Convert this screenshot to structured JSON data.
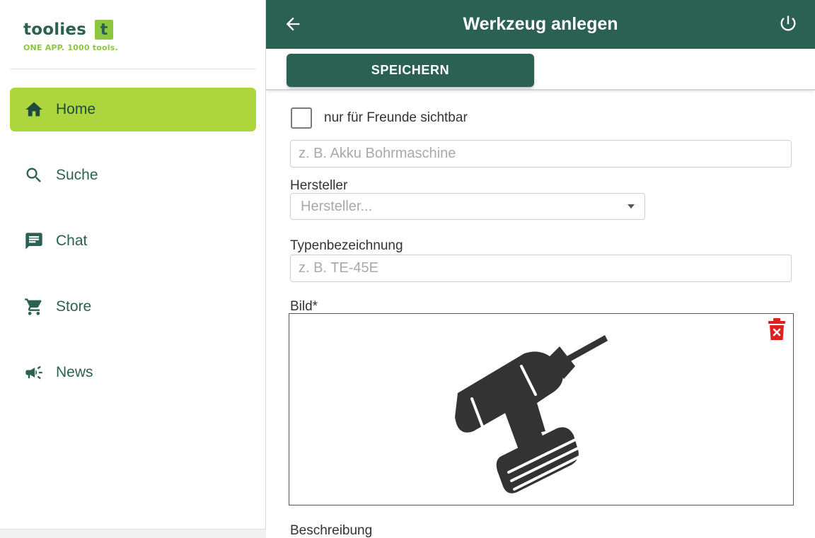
{
  "sidebar": {
    "logo": {
      "name": "toolies",
      "badge": "t",
      "tagline": "ONE APP. 1000 tools."
    },
    "items": [
      {
        "label": "Home",
        "icon": "home-icon",
        "active": true
      },
      {
        "label": "Suche",
        "icon": "search-icon",
        "active": false
      },
      {
        "label": "Chat",
        "icon": "chat-icon",
        "active": false
      },
      {
        "label": "Store",
        "icon": "cart-icon",
        "active": false
      },
      {
        "label": "News",
        "icon": "megaphone-icon",
        "active": false
      }
    ]
  },
  "header": {
    "title": "Werkzeug anlegen",
    "back_icon": "arrow-left-icon",
    "power_icon": "power-icon"
  },
  "toolbar": {
    "save_label": "SPEICHERN"
  },
  "form": {
    "friends_only": {
      "label": "nur für Freunde sichtbar",
      "checked": false
    },
    "name": {
      "value": "",
      "placeholder": "z. B. Akku Bohrmaschine"
    },
    "manufacturer": {
      "label": "Hersteller",
      "placeholder": "Hersteller..."
    },
    "type": {
      "label": "Typenbezeichnung",
      "value": "",
      "placeholder": "z. B. TE-45E"
    },
    "image": {
      "label": "Bild*",
      "icon": "drill-icon",
      "delete_icon": "trash-icon"
    },
    "description": {
      "label": "Beschreibung"
    }
  },
  "colors": {
    "brand_dark": "#2b6152",
    "brand_light": "#add53e",
    "danger": "#e0201d"
  }
}
